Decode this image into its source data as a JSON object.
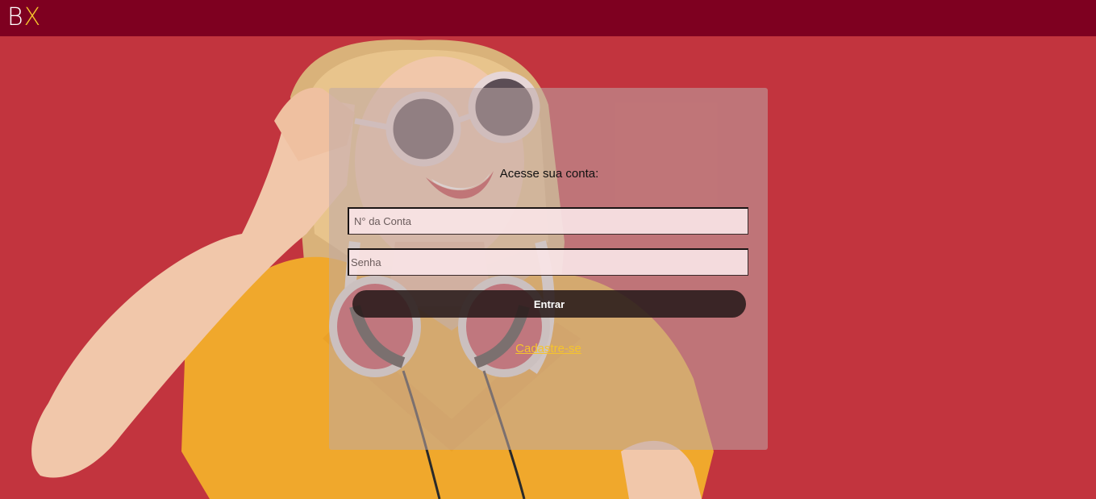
{
  "header": {
    "logo_b": "B",
    "logo_x": "X"
  },
  "hero": {
    "image": "woman-with-sunglasses-and-headphones-photo",
    "background_color": "#c2343e"
  },
  "login": {
    "title": "Acesse sua conta:",
    "account_placeholder": "N° da Conta",
    "password_placeholder": "Senha",
    "submit_label": "Entrar",
    "signup_link": "Cadastre-se"
  },
  "colors": {
    "header": "#7e0020",
    "accent": "#f6c42c",
    "background": "#c2343e"
  }
}
